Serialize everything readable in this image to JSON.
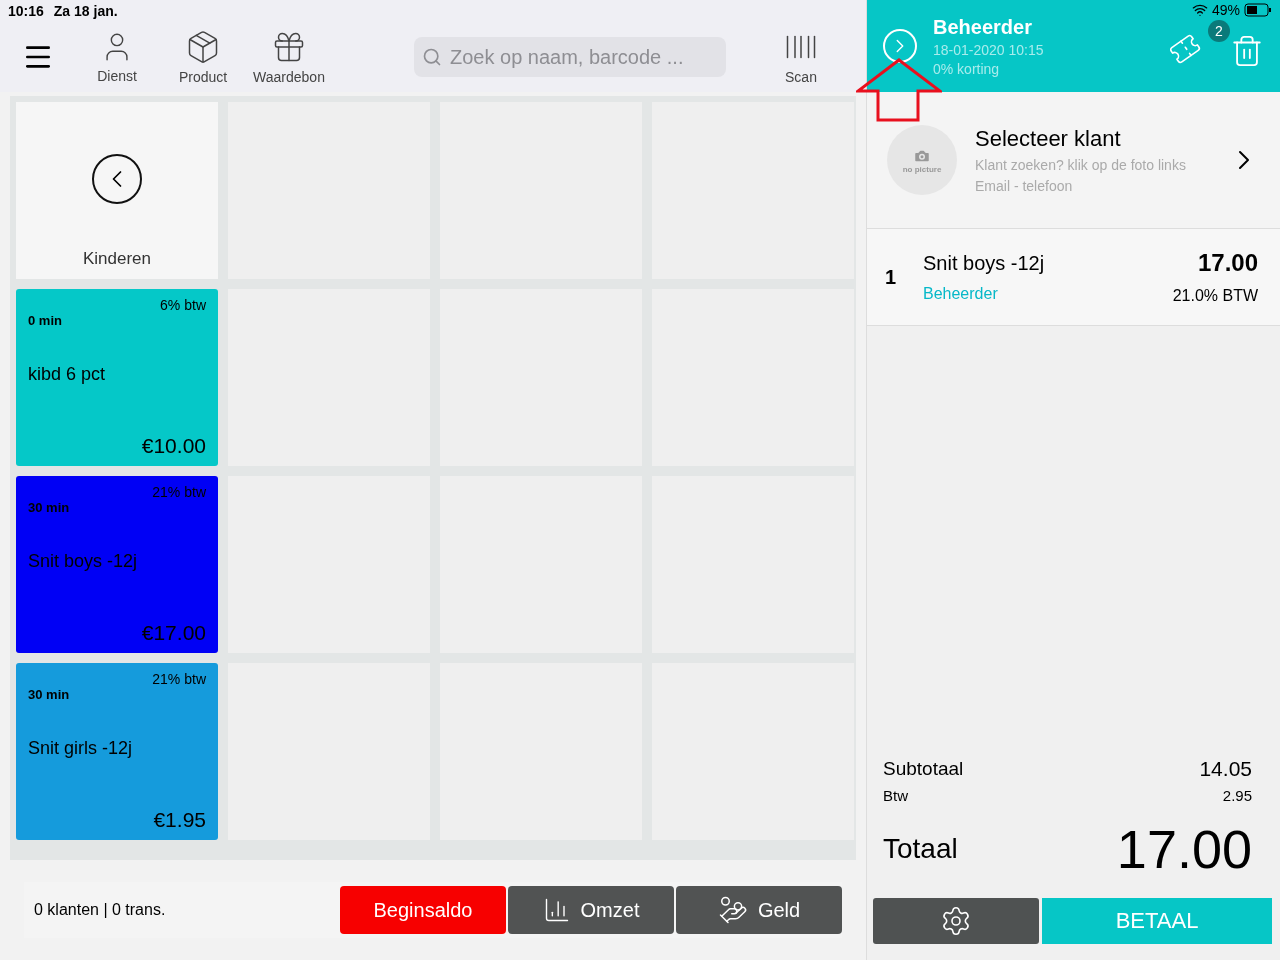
{
  "status_bar": {
    "time": "10:16",
    "date": "Za 18 jan.",
    "battery": "49%"
  },
  "toolbar": {
    "items": [
      {
        "label": "Dienst",
        "kind": "service"
      },
      {
        "label": "Product",
        "kind": "product"
      },
      {
        "label": "Waardebon",
        "kind": "voucher"
      }
    ],
    "search": {
      "placeholder": "Zoek op naam, barcode ..."
    },
    "scan": {
      "label": "Scan"
    }
  },
  "tiles": [
    {
      "kind": "back",
      "label": "Kinderen"
    },
    {
      "kind": "product",
      "color": "#05c8c8",
      "vat": "6% btw",
      "duration": "0 min",
      "name": "kibd 6 pct",
      "price": "€10.00"
    },
    {
      "kind": "product",
      "color": "#0000f5",
      "vat": "21% btw",
      "duration": "30 min",
      "name": "Snit boys -12j",
      "price": "€17.00"
    },
    {
      "kind": "product",
      "color": "#159bdc",
      "vat": "21% btw",
      "duration": "30 min",
      "name": "Snit girls -12j",
      "price": "€1.95"
    }
  ],
  "footer": {
    "summary": "0 klanten | 0 trans.",
    "buttons": [
      {
        "label": "Beginsaldo",
        "kind": "start"
      },
      {
        "label": "Omzet",
        "kind": "revenue"
      },
      {
        "label": "Geld",
        "kind": "money"
      }
    ]
  },
  "order": {
    "user": "Beheerder",
    "datetime": "18-01-2020 10:15",
    "discount": "0% korting",
    "voucher_count": "2"
  },
  "customer": {
    "title": "Selecteer klant",
    "hint": "Klant zoeken? klik op de foto links",
    "contact": "Email - telefoon",
    "photo_label": "no picture"
  },
  "lines": [
    {
      "qty": "1",
      "name": "Snit boys -12j",
      "staff": "Beheerder",
      "price": "17.00",
      "vat": "21.0% BTW"
    }
  ],
  "totals": {
    "subtotal_label": "Subtotaal",
    "subtotal": "14.05",
    "vat_label": "Btw",
    "vat": "2.95",
    "total_label": "Totaal",
    "total": "17.00"
  },
  "pay": {
    "label": "BETAAL"
  }
}
